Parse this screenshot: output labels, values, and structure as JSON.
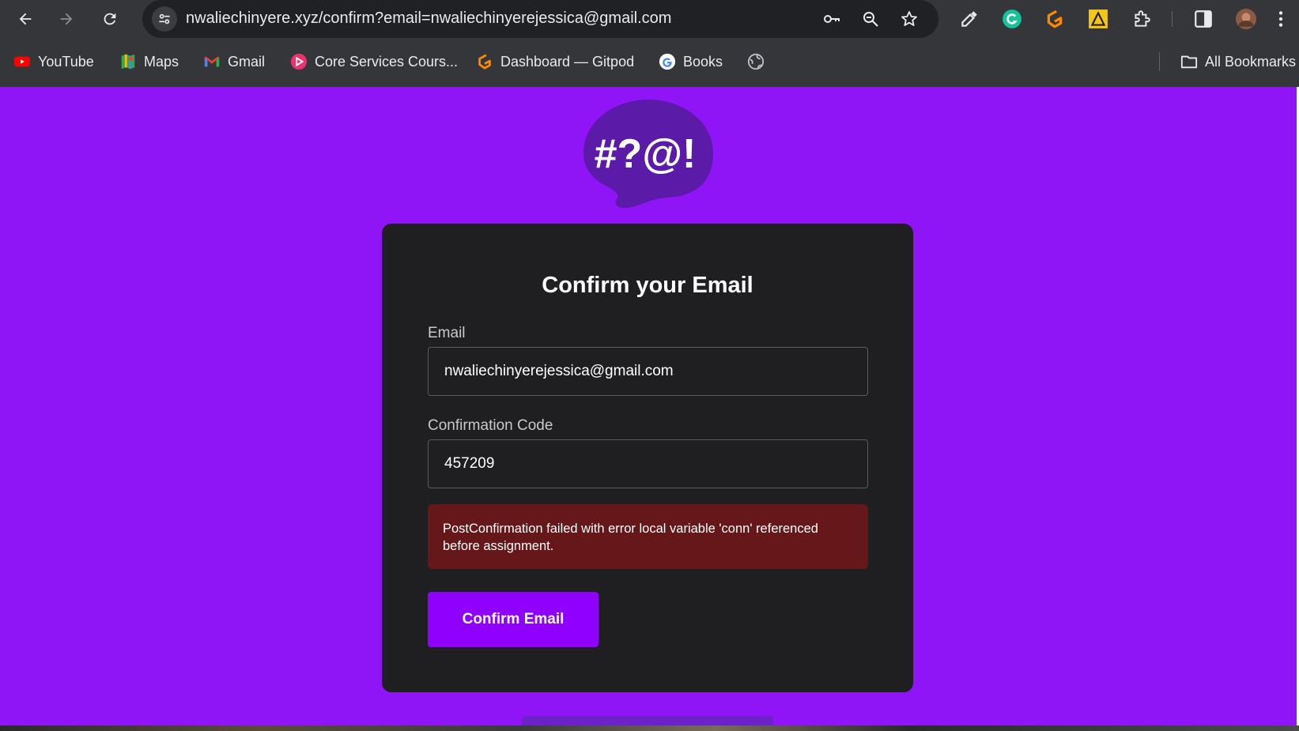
{
  "browser": {
    "url": "nwaliechinyere.xyz/confirm?email=nwaliechinyerejessica@gmail.com",
    "bookmarks": [
      {
        "label": "YouTube",
        "icon": "youtube-icon"
      },
      {
        "label": "Maps",
        "icon": "maps-icon"
      },
      {
        "label": "Gmail",
        "icon": "gmail-icon"
      },
      {
        "label": "Core Services Cours...",
        "icon": "core-services-icon"
      },
      {
        "label": "Dashboard — Gitpod",
        "icon": "gitpod-icon"
      },
      {
        "label": "Books",
        "icon": "google-icon"
      },
      {
        "label": "",
        "icon": "globe-icon"
      }
    ],
    "all_bookmarks_label": "All Bookmarks"
  },
  "page": {
    "logo_text": "#?@!",
    "title": "Confirm your Email",
    "email_label": "Email",
    "email_value": "nwaliechinyerejessica@gmail.com",
    "code_label": "Confirmation Code",
    "code_value": "457209",
    "error_message": "PostConfirmation failed with error local variable 'conn' referenced before assignment.",
    "submit_label": "Confirm Email"
  },
  "colors": {
    "page_background": "#8f15f7",
    "card_background": "#1f1f22",
    "error_background": "#651719",
    "button_background": "#8f00ff"
  }
}
